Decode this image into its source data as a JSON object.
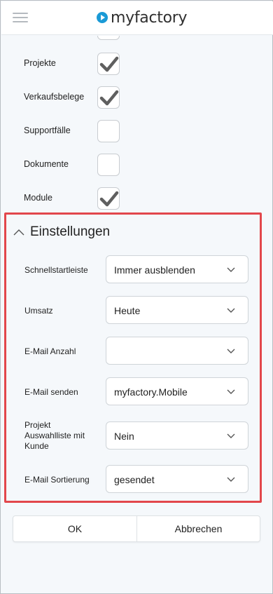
{
  "app": {
    "logo_text": "myfactory",
    "brand_color": "#1a9ad6"
  },
  "checkboxes": [
    {
      "label": "Projekte",
      "checked": true
    },
    {
      "label": "Verkaufsbelege",
      "checked": true
    },
    {
      "label": "Supportfälle",
      "checked": false
    },
    {
      "label": "Dokumente",
      "checked": false
    },
    {
      "label": "Module",
      "checked": true
    }
  ],
  "settings": {
    "title": "Einstellungen",
    "fields": [
      {
        "label": "Schnellstartleiste",
        "value": "Immer ausblenden"
      },
      {
        "label": "Umsatz",
        "value": "Heute"
      },
      {
        "label": "E-Mail Anzahl",
        "value": ""
      },
      {
        "label": "E-Mail senden",
        "value": "myfactory.Mobile"
      },
      {
        "label": "Projekt Auswahlliste mit Kunde",
        "value": "Nein"
      },
      {
        "label": "E-Mail Sortierung",
        "value": "gesendet"
      }
    ],
    "highlight_color": "#e2474c"
  },
  "buttons": {
    "ok": "OK",
    "cancel": "Abbrechen"
  }
}
